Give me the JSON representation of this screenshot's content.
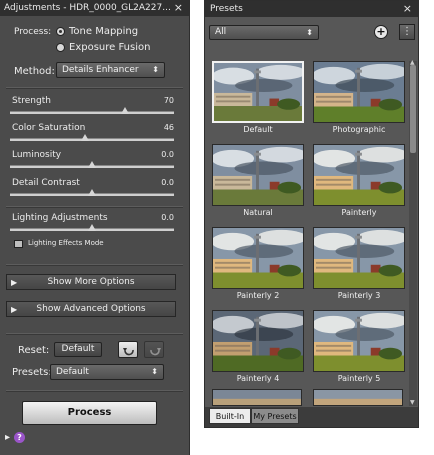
{
  "adjustments": {
    "title": "Adjustments - HDR_0000_GL2A227...",
    "close_glyph": "×",
    "process": {
      "label": "Process:",
      "options": [
        "Tone Mapping",
        "Exposure Fusion"
      ],
      "selected": 0
    },
    "method": {
      "label": "Method:",
      "value": "Details Enhancer",
      "arrow": "⬍"
    },
    "sliders": [
      {
        "label": "Strength",
        "value": "70",
        "fraction": 0.7
      },
      {
        "label": "Color Saturation",
        "value": "46",
        "fraction": 0.46
      },
      {
        "label": "Luminosity",
        "value": "0.0",
        "fraction": 0.5
      },
      {
        "label": "Detail Contrast",
        "value": "0.0",
        "fraction": 0.5
      },
      {
        "label": "Lighting Adjustments",
        "value": "0.0",
        "fraction": 0.5
      }
    ],
    "lighting_mode_label": "Lighting Effects Mode",
    "show_more": "Show More Options",
    "show_advanced": "Show Advanced Options",
    "reset": {
      "label": "Reset:",
      "button": "Default"
    },
    "presets": {
      "label": "Presets:",
      "value": "Default",
      "arrow": "⬍"
    },
    "process_button": "Process",
    "footer": {
      "expand_glyph": "▸",
      "help_glyph": "?"
    }
  },
  "presets_panel": {
    "title": "Presets",
    "close_glyph": "×",
    "filter": {
      "value": "All",
      "arrow": "⬍"
    },
    "add_glyph": "+",
    "menu_glyph": "⋮",
    "items": [
      {
        "label": "Default",
        "selected": true,
        "tone": "natural"
      },
      {
        "label": "Photographic",
        "selected": false,
        "tone": "photo"
      },
      {
        "label": "Natural",
        "selected": false,
        "tone": "natural"
      },
      {
        "label": "Painterly",
        "selected": false,
        "tone": "painterly"
      },
      {
        "label": "Painterly 2",
        "selected": false,
        "tone": "painterly"
      },
      {
        "label": "Painterly 3",
        "selected": false,
        "tone": "painterly"
      },
      {
        "label": "Painterly 4",
        "selected": false,
        "tone": "dark"
      },
      {
        "label": "Painterly 5",
        "selected": false,
        "tone": "painterly"
      }
    ],
    "tabs": [
      {
        "label": "Built-In",
        "active": true
      },
      {
        "label": "My Presets",
        "active": false
      }
    ],
    "colors": {
      "selected_border": "#f2f2f2",
      "panel": "#575757"
    }
  }
}
